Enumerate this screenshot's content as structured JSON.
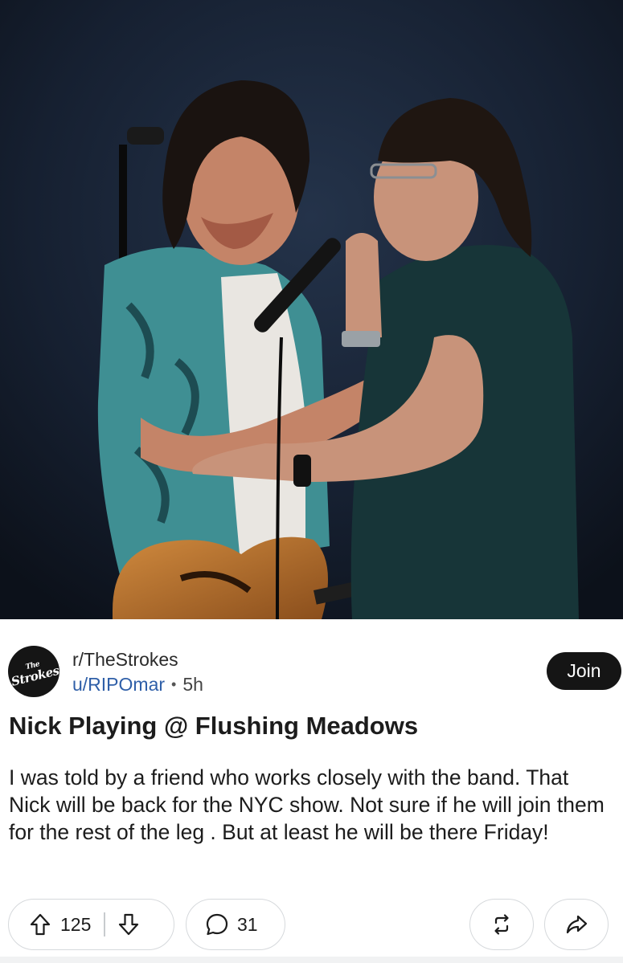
{
  "photo": {
    "description_icon": "concert-photo"
  },
  "post": {
    "subreddit": "r/TheStrokes",
    "author": "u/RIPOmar",
    "separator": "•",
    "age": "5h",
    "join_label": "Join",
    "title": "Nick Playing @ Flushing Meadows",
    "body": "I was told by a friend who works closely with the band. That Nick will be back for the NYC show. Not sure if he will join them for the rest of the leg . But at least he will be there Friday!",
    "avatar": {
      "line1": "The",
      "line2": "Strokes"
    }
  },
  "actions": {
    "upvotes": "125",
    "comments": "31"
  },
  "colors": {
    "join_bg": "#151515",
    "author_link": "#2f5fa8",
    "pill_border": "#d6d9dc"
  }
}
